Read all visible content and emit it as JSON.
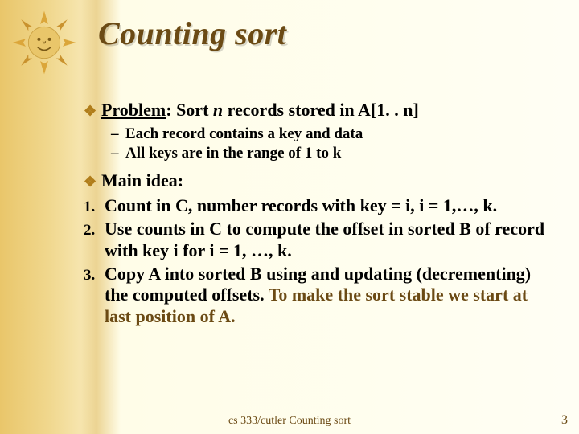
{
  "title": "Counting sort",
  "bullets": {
    "problem": {
      "label": "Problem",
      "rest": ": Sort n records stored in A[1. . n]",
      "subs": [
        "Each record contains a key and data",
        "All keys are in the range of 1 to k"
      ]
    },
    "mainIdea": "Main idea:"
  },
  "steps": [
    {
      "num": "1.",
      "pre": "Count  in C, number records with ",
      "em1": "key = i",
      "mid": ", ",
      "em2": "i = 1,…, k",
      "post": "."
    },
    {
      "num": "2.",
      "text": "Use counts in C to compute the offset in sorted B of record with key i for i = 1, …, k."
    },
    {
      "num": "3.",
      "text": "Copy A into sorted B using and updating (decrementing) the  computed offsets. ",
      "emphasis": "To make the sort stable we start at last position of A."
    }
  ],
  "footer": "cs 333/cutler  Counting sort",
  "pageNumber": "3"
}
